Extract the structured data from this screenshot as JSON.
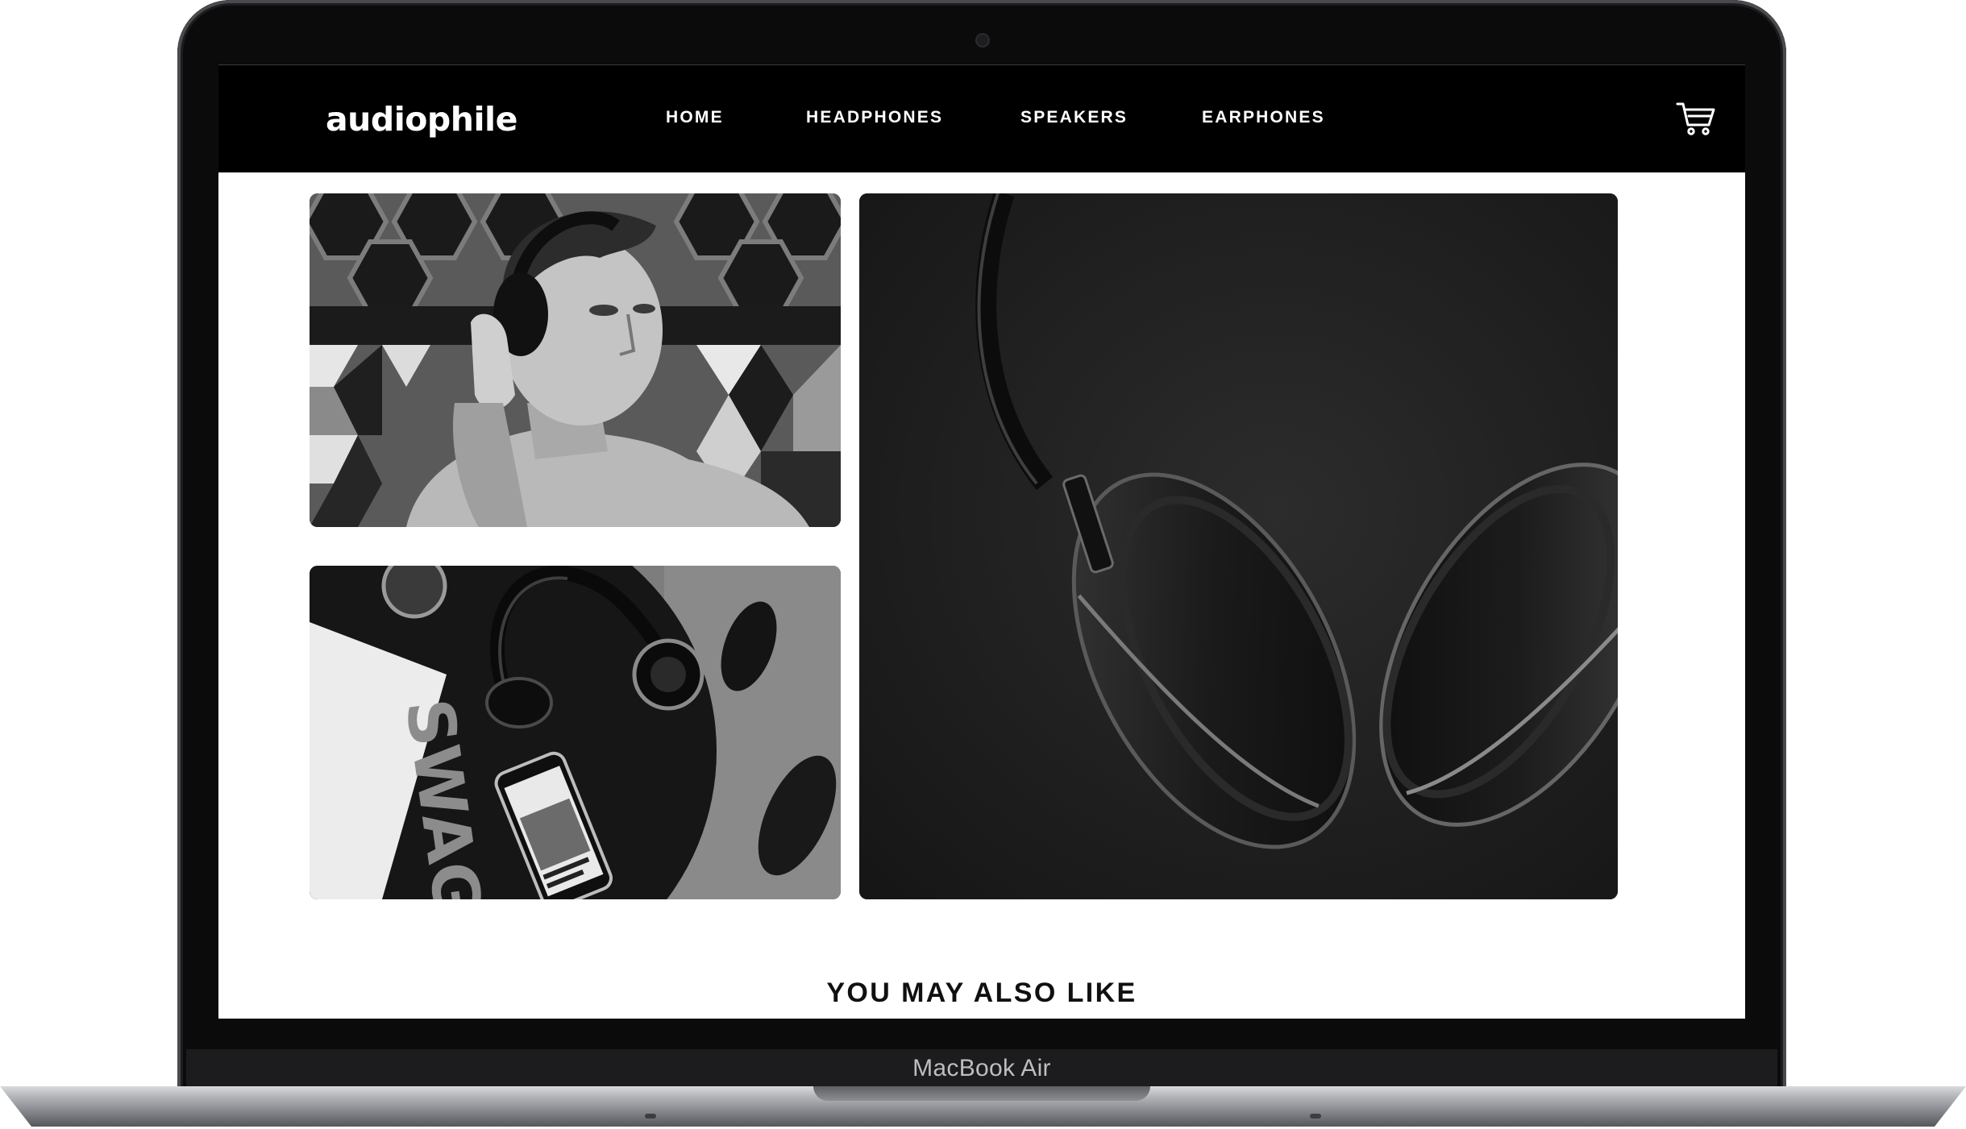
{
  "device": {
    "label": "MacBook Air"
  },
  "header": {
    "logo": "audiophile",
    "nav": [
      {
        "label": "HOME"
      },
      {
        "label": "HEADPHONES"
      },
      {
        "label": "SPEAKERS"
      },
      {
        "label": "EARPHONES"
      }
    ],
    "cart_icon": "shopping-cart-icon"
  },
  "gallery": {
    "images": [
      {
        "subject": "man-with-headphones-photo"
      },
      {
        "subject": "headphones-on-table-photo",
        "magazine_text": "SWAGG"
      },
      {
        "subject": "headphones-closeup-photo"
      }
    ]
  },
  "section": {
    "heading": "YOU MAY ALSO LIKE"
  },
  "colors": {
    "nav_background": "#000000",
    "page_background": "#ffffff",
    "text_dark": "#101010"
  }
}
